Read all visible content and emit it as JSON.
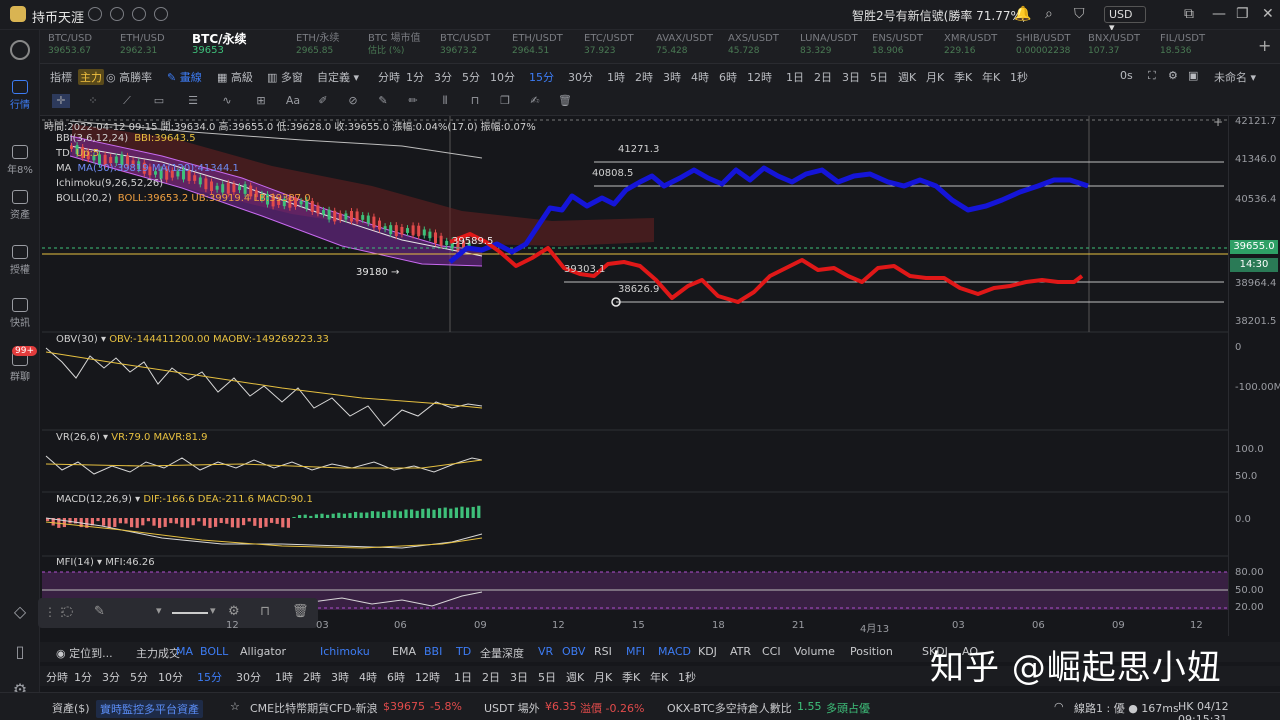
{
  "app": {
    "title": "持币天涯",
    "notice": "智胜2号有新信號(勝率 71.77%)",
    "currency": "USD ▾"
  },
  "sidebar": [
    {
      "label": "行情",
      "icon": "market-icon",
      "active": true
    },
    {
      "label": "年8%",
      "icon": "yield-icon",
      "active": false
    },
    {
      "label": "资產",
      "icon": "assets-icon",
      "active": false
    },
    {
      "label": "授權",
      "icon": "auth-icon",
      "active": false
    },
    {
      "label": "快訊",
      "icon": "news-icon",
      "active": false
    },
    {
      "label": "群聊",
      "icon": "chat-icon",
      "active": false
    }
  ],
  "sidebar_badge": "99+",
  "tabs": [
    {
      "name": "BTC/USD",
      "price": "39653.67"
    },
    {
      "name": "ETH/USD",
      "price": "2962.31"
    },
    {
      "name": "BTC/永续",
      "price": "39653",
      "active": true
    },
    {
      "name": "ETH/永续",
      "price": "2965.85"
    },
    {
      "name": "BTC 場市值",
      "price": "估比 (%)"
    },
    {
      "name": "BTC/USDT",
      "price": "39673.2"
    },
    {
      "name": "ETH/USDT",
      "price": "2964.51"
    },
    {
      "name": "ETC/USDT",
      "price": "37.923"
    },
    {
      "name": "AVAX/USDT",
      "price": "75.428"
    },
    {
      "name": "AXS/USDT",
      "price": "45.728"
    },
    {
      "name": "LUNA/USDT",
      "price": "83.329"
    },
    {
      "name": "ENS/USDT",
      "price": "18.906"
    },
    {
      "name": "XMR/USDT",
      "price": "229.16"
    },
    {
      "name": "SHIB/USDT",
      "price": "0.00002238"
    },
    {
      "name": "BNX/USDT",
      "price": "107.37"
    },
    {
      "name": "FIL/USDT",
      "price": "18.536"
    }
  ],
  "toolbar1": [
    {
      "label": "指標",
      "type": "normal"
    },
    {
      "label": "主力",
      "type": "tag"
    },
    {
      "label": "◎ 高勝率",
      "type": "normal"
    },
    {
      "label": "✎ 畫線",
      "type": "active"
    },
    {
      "label": "▦ 高級",
      "type": "normal"
    },
    {
      "label": "▥ 多窗",
      "type": "normal"
    },
    {
      "label": "自定義 ▾",
      "type": "normal"
    },
    {
      "label": "分時",
      "type": "normal"
    },
    {
      "label": "1分",
      "type": "normal"
    },
    {
      "label": "3分",
      "type": "normal"
    },
    {
      "label": "5分",
      "type": "normal"
    },
    {
      "label": "10分",
      "type": "normal"
    },
    {
      "label": "15分",
      "type": "active"
    },
    {
      "label": "30分",
      "type": "normal"
    },
    {
      "label": "1時",
      "type": "normal"
    },
    {
      "label": "2時",
      "type": "normal"
    },
    {
      "label": "3時",
      "type": "normal"
    },
    {
      "label": "4時",
      "type": "normal"
    },
    {
      "label": "6時",
      "type": "normal"
    },
    {
      "label": "12時",
      "type": "normal"
    },
    {
      "label": "1日",
      "type": "normal"
    },
    {
      "label": "2日",
      "type": "normal"
    },
    {
      "label": "3日",
      "type": "normal"
    },
    {
      "label": "5日",
      "type": "normal"
    },
    {
      "label": "週K",
      "type": "normal"
    },
    {
      "label": "月K",
      "type": "normal"
    },
    {
      "label": "季K",
      "type": "normal"
    },
    {
      "label": "年K",
      "type": "normal"
    },
    {
      "label": "1秒",
      "type": "normal"
    }
  ],
  "toolbar1_right": {
    "countdown": "0s",
    "layout": "未命名 ▾"
  },
  "ohlc": "時間:2022-04-12 09:15  開:39634.0  高:39655.0  低:39628.0  收:39655.0  漲幅:0.04%(17.0)  振幅:0.07%",
  "indicators_main": [
    {
      "label": "BBI(3,6,12,24)",
      "value": "BBI:39643.5"
    },
    {
      "label": "TD",
      "value": "Up:5"
    },
    {
      "label": "MA",
      "value": "MA(30):39819  MA(120):41344.1"
    },
    {
      "label": "Ichimoku(9,26,52,26)",
      "value": ""
    },
    {
      "label": "BOLL(20,2)",
      "value": "BOLL:39653.2  UB:39919.4  LB:39387.0"
    }
  ],
  "annotations": {
    "low_label": "39180 →",
    "cross_price": "39589.5",
    "l1": "41271.3",
    "l2": "40808.5",
    "l3": "39303.1",
    "l4": "38626.9"
  },
  "price_axis": [
    "42121.7",
    "41346.0",
    "40536.4",
    "38964.4",
    "38201.5"
  ],
  "price_tag": {
    "current": "39655.0",
    "countdown": "14:30"
  },
  "obv": {
    "label": "OBV(30)",
    "values": "OBV:-144411200.00  MAOBV:-149269223.33",
    "axis": [
      "0",
      "-100.00M"
    ]
  },
  "vr": {
    "label": "VR(26,6)",
    "values": "VR:79.0  MAVR:81.9",
    "axis": [
      "100.0",
      "50.0"
    ]
  },
  "macd": {
    "label": "MACD(12,26,9)",
    "values": "DIF:-166.6  DEA:-211.6  MACD:90.1",
    "axis": [
      "0.0"
    ]
  },
  "mfi": {
    "label": "MFI(14)",
    "values": "MFI:46.26",
    "axis": [
      "80.00",
      "50.00",
      "20.00"
    ]
  },
  "date_axis": [
    "12",
    "03",
    "06",
    "09",
    "12",
    "15",
    "18",
    "21",
    "4月13",
    "03",
    "06",
    "09",
    "12"
  ],
  "indicator_bar": [
    {
      "label": "◉ 定位到...",
      "type": "normal"
    },
    {
      "label": "主力成交",
      "type": "normal"
    },
    {
      "label": "MA",
      "type": "blue"
    },
    {
      "label": "BOLL",
      "type": "blue"
    },
    {
      "label": "Alligator",
      "type": "normal"
    },
    {
      "label": "Ichimoku",
      "type": "blue"
    },
    {
      "label": "EMA",
      "type": "normal"
    },
    {
      "label": "BBI",
      "type": "blue"
    },
    {
      "label": "TD",
      "type": "blue"
    },
    {
      "label": "全量深度",
      "type": "normal"
    },
    {
      "label": "VR",
      "type": "blue"
    },
    {
      "label": "OBV",
      "type": "blue"
    },
    {
      "label": "RSI",
      "type": "normal"
    },
    {
      "label": "MFI",
      "type": "blue"
    },
    {
      "label": "MACD",
      "type": "blue"
    },
    {
      "label": "KDJ",
      "type": "normal"
    },
    {
      "label": "ATR",
      "type": "normal"
    },
    {
      "label": "CCI",
      "type": "normal"
    },
    {
      "label": "Volume",
      "type": "normal"
    },
    {
      "label": "Position",
      "type": "normal"
    },
    {
      "label": "SKDJ",
      "type": "normal"
    },
    {
      "label": "AO",
      "type": "normal"
    }
  ],
  "timeframe_bar": [
    "分時",
    "1分",
    "3分",
    "5分",
    "10分",
    "15分",
    "30分",
    "1時",
    "2時",
    "3時",
    "4時",
    "6時",
    "12時",
    "1日",
    "2日",
    "3日",
    "5日",
    "週K",
    "月K",
    "季K",
    "年K",
    "1秒"
  ],
  "timeframe_active": "15分",
  "status": {
    "assets": "資產($)",
    "monitor": "實時監控多平台資產",
    "cme": "CME比特幣期貨CFD-新浪",
    "cme_price": "$39675",
    "cme_change": "-5.8%",
    "usdt": "USDT 場外",
    "usdt_price": "¥6.35",
    "usdt_premium": "溢價 -0.26%",
    "okx": "OKX-BTC多空持倉人數比",
    "okx_value": "1.55",
    "okx_state": "多頭占優",
    "line": "線路1 : 優 ● 167ms",
    "time": "HK 04/12 09:15:31"
  },
  "watermark": "知乎 @崛起思小妞",
  "colors": {
    "up": "#3ec07a",
    "down": "#e24b4b",
    "accent": "#3d7cf4",
    "projection_blue": "#1515d8",
    "projection_red": "#e01818"
  }
}
